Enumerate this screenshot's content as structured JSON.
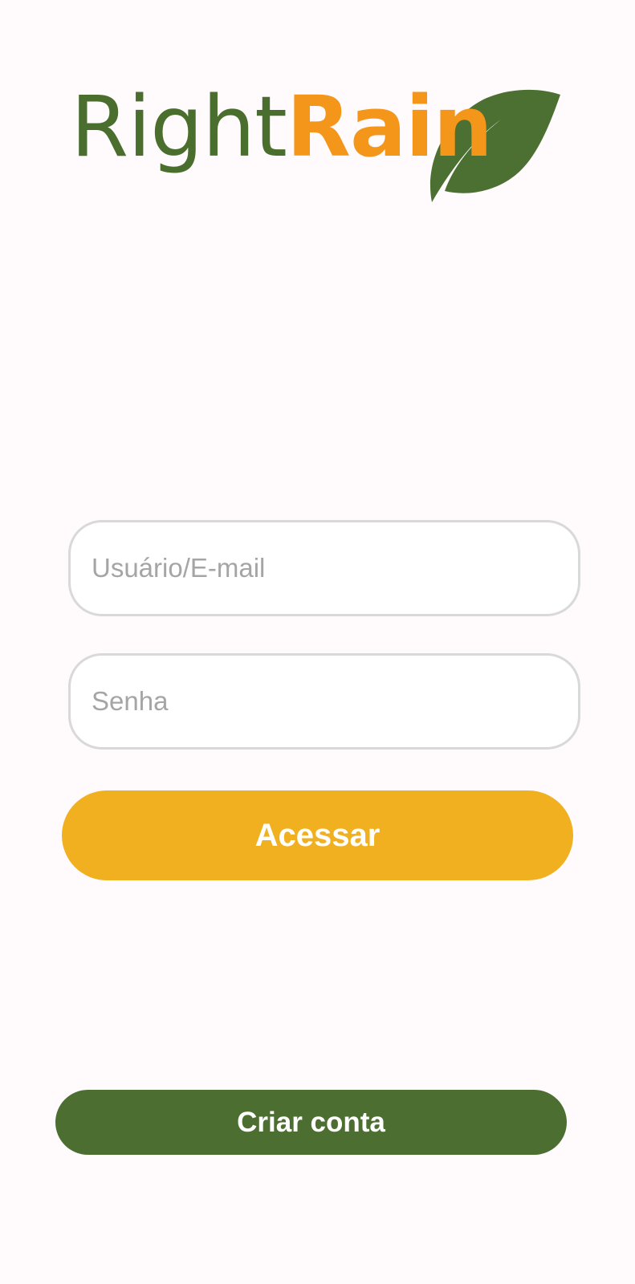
{
  "logo": {
    "text_part_1": "Right",
    "text_part_2": "Rain",
    "leaf_icon": "leaf-icon",
    "colors": {
      "green": "#4a6e2d",
      "orange": "#f3961a"
    }
  },
  "form": {
    "username_placeholder": "Usuário/E-mail",
    "password_placeholder": "Senha"
  },
  "buttons": {
    "access": "Acessar",
    "create_account": "Criar conta"
  },
  "colors": {
    "background": "#fffafc",
    "access_button": "#f1b020",
    "create_button": "#4c6f31",
    "field_border": "#d9d9d9",
    "placeholder": "#a5a5a5"
  }
}
